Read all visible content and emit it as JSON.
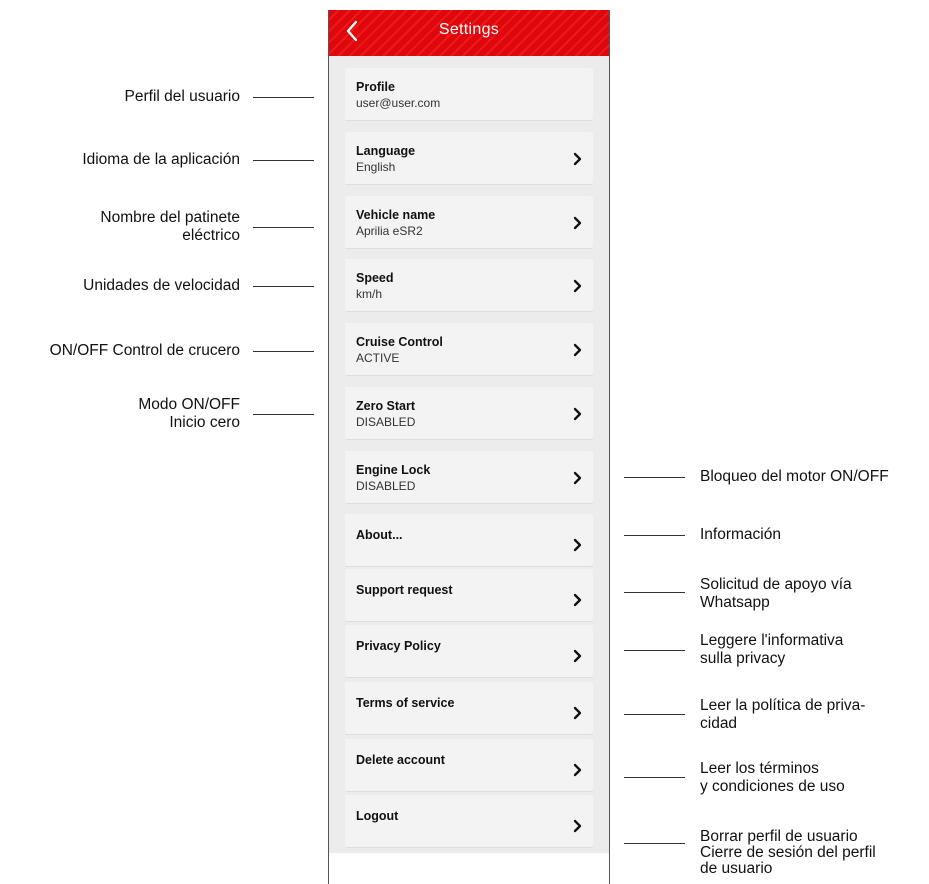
{
  "header": {
    "title": "Settings",
    "back_icon": "chevron-left-icon",
    "color": "#e30b10"
  },
  "items": [
    {
      "title": "Profile",
      "value": "user@user.com",
      "chevron": false
    },
    {
      "title": "Language",
      "value": "English",
      "chevron": true
    },
    {
      "title": "Vehicle name",
      "value": "Aprilia eSR2",
      "chevron": true
    },
    {
      "title": "Speed",
      "value": "km/h",
      "chevron": true
    },
    {
      "title": "Cruise Control",
      "value": "ACTIVE",
      "chevron": true
    },
    {
      "title": "Zero Start",
      "value": "DISABLED",
      "chevron": true
    },
    {
      "title": "Engine Lock",
      "value": "DISABLED",
      "chevron": true
    },
    {
      "title": "About...",
      "value": "",
      "chevron": true
    },
    {
      "title": "Support request",
      "value": "",
      "chevron": true
    },
    {
      "title": "Privacy Policy",
      "value": "",
      "chevron": true
    },
    {
      "title": "Terms of service",
      "value": "",
      "chevron": true
    },
    {
      "title": "Delete account",
      "value": "",
      "chevron": true
    },
    {
      "title": "Logout",
      "value": "",
      "chevron": true
    }
  ],
  "annotations_left": [
    {
      "lines": [
        "Perfil del usuario"
      ]
    },
    {
      "lines": [
        "Idioma de la aplicación"
      ]
    },
    {
      "lines": [
        "Nombre del patinete",
        "eléctrico"
      ]
    },
    {
      "lines": [
        "Unidades de velocidad"
      ]
    },
    {
      "lines": [
        "ON/OFF Control de crucero"
      ]
    },
    {
      "lines": [
        "Modo ON/OFF",
        "Inicio cero"
      ]
    }
  ],
  "annotations_right": [
    {
      "lines": [
        "Bloqueo del motor ON/OFF"
      ]
    },
    {
      "lines": [
        "Información"
      ]
    },
    {
      "lines": [
        "Solicitud de apoyo vía",
        "Whatsapp"
      ]
    },
    {
      "lines": [
        "Leggere l'informativa",
        "sulla privacy"
      ]
    },
    {
      "lines": [
        "Leer la política de priva-",
        "cidad"
      ]
    },
    {
      "lines": [
        "Leer los términos",
        "y condiciones de uso"
      ]
    },
    {
      "lines": [
        "Borrar perfil de usuario",
        "Cierre de sesión del perfil",
        "de usuario"
      ]
    }
  ]
}
